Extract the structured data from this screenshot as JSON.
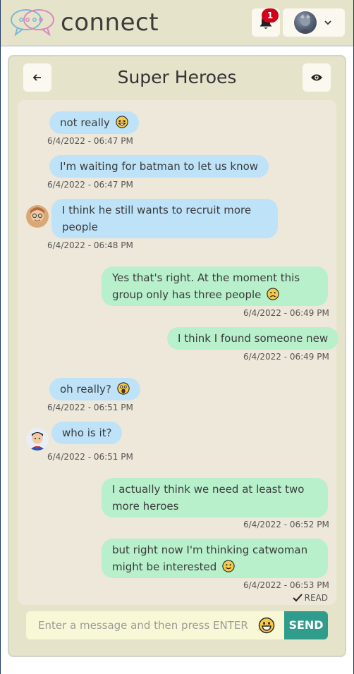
{
  "app": {
    "brand": "connect"
  },
  "notifications": {
    "count": "1",
    "icon": "bell-icon"
  },
  "chat": {
    "title": "Super Heroes",
    "messages": [
      {
        "dir": "in",
        "text": "not really",
        "emoji": "laughing",
        "time": "6/4/2022 - 06:47 PM",
        "avatar": false
      },
      {
        "dir": "in",
        "text": "I'm waiting for batman to let us know",
        "time": "6/4/2022 - 06:47 PM",
        "avatar": false
      },
      {
        "dir": "in",
        "text": "I think he still wants to recruit more people",
        "time": "6/4/2022 - 06:48 PM",
        "avatar": true
      },
      {
        "dir": "out",
        "text": "Yes that's right. At the moment this group only has three people",
        "emoji": "worried",
        "time": "6/4/2022 - 06:49 PM"
      },
      {
        "dir": "out",
        "text": "I think I found someone new",
        "time": "6/4/2022 - 06:49 PM"
      },
      {
        "dir": "in",
        "text": "oh really?",
        "emoji": "astonished",
        "time": "6/4/2022 - 06:51 PM",
        "avatar": false
      },
      {
        "dir": "in",
        "text": "who is it?",
        "time": "6/4/2022 - 06:51 PM",
        "avatar": true
      },
      {
        "dir": "out",
        "text": "I actually think we need at least two more heroes",
        "time": "6/4/2022 - 06:52 PM"
      },
      {
        "dir": "out",
        "text": "but right now I'm thinking catwoman might be interested",
        "emoji": "smile",
        "time": "6/4/2022 - 06:53 PM"
      }
    ],
    "read_label": "READ"
  },
  "composer": {
    "placeholder": "Enter a message and then press ENTER",
    "value": "",
    "send_label": "SEND"
  },
  "colors": {
    "navbar": "#e6e3cb",
    "incoming_bubble": "#bee3f8",
    "outgoing_bubble": "#b8f0cc",
    "send_button": "#2f9c8c",
    "badge": "#d0021b"
  }
}
